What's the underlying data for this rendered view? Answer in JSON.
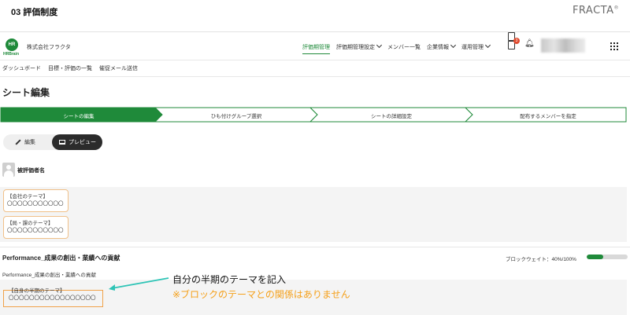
{
  "slide": {
    "title": "03 評価制度",
    "brand": "FRACTA",
    "brand_mark": "®"
  },
  "header": {
    "logo_text": "HR",
    "logo_subtext": "HRBrain",
    "company": "株式会社フラクタ",
    "nav": [
      "評価期管理",
      "評価期管理設定",
      "メンバー一覧",
      "企業情報",
      "運用管理"
    ],
    "notification_count": "3"
  },
  "subnav": [
    "ダッシュボード",
    "目標・評価の一覧",
    "催促メール送信"
  ],
  "page_title": "シート編集",
  "steps": [
    "シートの編集",
    "ひも付けグループ選択",
    "シートの詳細設定",
    "配布するメンバーを指定"
  ],
  "toggle": {
    "edit": "編集",
    "preview": "プレビュー"
  },
  "evaluatee_label": "被評価者名",
  "themes": [
    {
      "title": "【会社のテーマ】",
      "value": "〇〇〇〇〇〇〇〇〇〇〇"
    },
    {
      "title": "【局・課のテーマ】",
      "value": "〇〇〇〇〇〇〇〇〇〇〇"
    }
  ],
  "section": {
    "title": "Performance_成果の創出・業績への貢献",
    "weight_label": "ブロックウェイト：40%/100%",
    "weight_fraction": 0.4,
    "sub_label": "Performance_成果の創出・業績への貢献",
    "self_title": "【自身の半期のテーマ】",
    "self_value": "〇〇〇〇〇〇〇〇〇〇〇〇〇〇〇〇〇"
  },
  "annotation": {
    "main": "自分の半期のテーマを記入",
    "note": "※ブロックのテーマとの関係はありません"
  },
  "colors": {
    "accent": "#1f8a3a",
    "highlight_border": "#f0a24a",
    "note_text": "#f5a01a",
    "arrow": "#2ec4b6"
  }
}
